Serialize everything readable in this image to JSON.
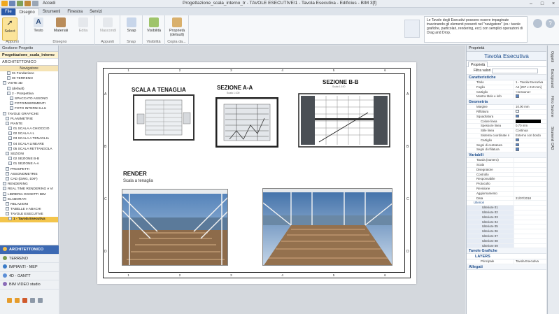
{
  "window": {
    "title": "Progettazione_scala_interno_tr - TAVOLE ESECUTIVE\\1 - Tavola Esecutiva - Edificius - BIM 3[f]",
    "quick_label": "Accedi"
  },
  "tabs": [
    "File",
    "Disegno",
    "Strumenti",
    "Finestra",
    "Servizi"
  ],
  "ribbon": {
    "buttons": [
      {
        "label": "Select"
      },
      {
        "label": "Testo"
      },
      {
        "label": "Materiali"
      },
      {
        "label": "Edita"
      },
      {
        "label": "Nascondi"
      },
      {
        "label": "Snap"
      },
      {
        "label": "Visibilità"
      },
      {
        "label": "Proprietà (default)"
      }
    ],
    "groups": [
      "Appunti",
      "Disegno",
      "Appunti",
      "Snap",
      "Visibilità",
      "Copia da..."
    ],
    "help_text": "Le Tavole degli Esecutivi possono essere impaginate trascinando gli elementi presenti nel \"navigatore\" (es.: tavole grafiche, particolari, rendering, ecc) con semplici operazioni di Drag and Drop."
  },
  "left_panel": {
    "header": "Gestione Progetto",
    "project": "Progettazione_scala_interno",
    "section": "ARCHITETTONICO",
    "navigator": "Navigatore",
    "tree": [
      "01 Fondazione",
      "00 TERRENO",
      "VISTE 3D",
      "(default)",
      "2 - Prospettiva",
      "SPACCATO ASSONO",
      "FOTOINSERIMENTI",
      "FOTO INTERNI ILLU",
      "TAVOLE GRAFICHE",
      "PLANIMETRIE",
      "PIANTE",
      "01 SCALA A CHIOCCIO",
      "02 SCALA A L",
      "03 SCALA A TENAGLIA",
      "04 SCALA LINEARE",
      "05 SCALA RETTANGOLA",
      "SEZIONI",
      "02 SEZIONE B-B",
      "01 SEZIONE A-A",
      "PROSPETTI",
      "ASSONOMETRIE",
      "CAD (DWG, DXF)",
      "RENDERING",
      "REAL TIME RENDERING e VI",
      "LIBRERIA OGGETTI BIM",
      "ELABORATI",
      "RELAZIONI",
      "TABELLE e ABACHI",
      "TAVOLE ESECUTIVE",
      "1 - Tavola Esecutiva"
    ],
    "bottom_items": [
      "ARCHITETTONICO",
      "TERRENO",
      "IMPIANTI - MEP",
      "4D - GANTT",
      "BIM VIDEO studio"
    ]
  },
  "sheet": {
    "columns": [
      "1",
      "2",
      "3",
      "4",
      "5",
      "6"
    ],
    "rows": [
      "A",
      "B",
      "C",
      "D"
    ],
    "titles": {
      "tenaglia": "SCALA A TENAGLIA",
      "sez_aa": "SEZIONE A-A",
      "sez_aa_scale": "Scala 1:100",
      "sez_bb": "SEZIONE B-B",
      "sez_bb_scale": "Scala 1:100",
      "render": "RENDER",
      "render_sub": "Scala a tenaglia"
    }
  },
  "right_panel": {
    "header": "Proprietà",
    "title": "Tavola Esecutiva",
    "tab": "Proprietà",
    "filter_label": "Filtra valori",
    "sections": {
      "caratteristiche": "Caratteristiche",
      "geometria": "Geometria",
      "variabili": "Variabili",
      "tavole_grafiche": "Tavole Grafiche",
      "layers": "LAYERS",
      "allegati": "Allegati"
    },
    "caratteristiche": [
      {
        "k": "Titolo",
        "v": "1 - Tavola Esecutiva"
      },
      {
        "k": "Foglio",
        "v": "A4 [297 x 210 mm]"
      },
      {
        "k": "Cartiglio",
        "v": "<nessuno>"
      },
      {
        "k": "Mostra titolo e info",
        "v": ""
      }
    ],
    "geometria": [
      {
        "k": "Margine",
        "v": "10.00 mm"
      },
      {
        "k": "Rifilatura",
        "v": ""
      },
      {
        "k": "Squadratura",
        "v": ""
      },
      {
        "k": "Colore linea",
        "v": ""
      },
      {
        "k": "Spessore linea",
        "v": "0.70 mm"
      },
      {
        "k": "Stile linea",
        "v": "Continua"
      },
      {
        "k": "Sistema coordinate n",
        "v": "Esterno con bordo"
      },
      {
        "k": "Cartiglio",
        "v": ""
      },
      {
        "k": "Segni di centratura",
        "v": ""
      },
      {
        "k": "Segni di rifilatura",
        "v": ""
      }
    ],
    "variabili": [
      {
        "k": "Tavola (numero)",
        "v": ""
      },
      {
        "k": "Scala",
        "v": ""
      },
      {
        "k": "Disegnatore",
        "v": ""
      },
      {
        "k": "Controllo",
        "v": ""
      },
      {
        "k": "Responsabile",
        "v": ""
      },
      {
        "k": "Protocollo",
        "v": ""
      },
      {
        "k": "Revisione",
        "v": ""
      },
      {
        "k": "Aggiornamento",
        "v": ""
      },
      {
        "k": "Data",
        "v": "21/07/2018"
      }
    ],
    "ulteriori_label": "Ulteriori",
    "ulteriori": [
      "Ulteriore 01",
      "Ulteriore 02",
      "Ulteriore 03",
      "Ulteriore 04",
      "Ulteriore 05",
      "Ulteriore 06",
      "Ulteriore 07",
      "Ulteriore 08",
      "Ulteriore 09"
    ],
    "layers_row": {
      "k": "Principale",
      "v": "Tavola Esecutiva"
    }
  },
  "right_dock": [
    "Oggetti",
    "Background",
    "Filtro Sezione",
    "Strumenti CAD"
  ],
  "colors": {
    "accent": "#2b5aa8",
    "selection": "#f3c54c",
    "panel_title": "#1f4e8c"
  }
}
